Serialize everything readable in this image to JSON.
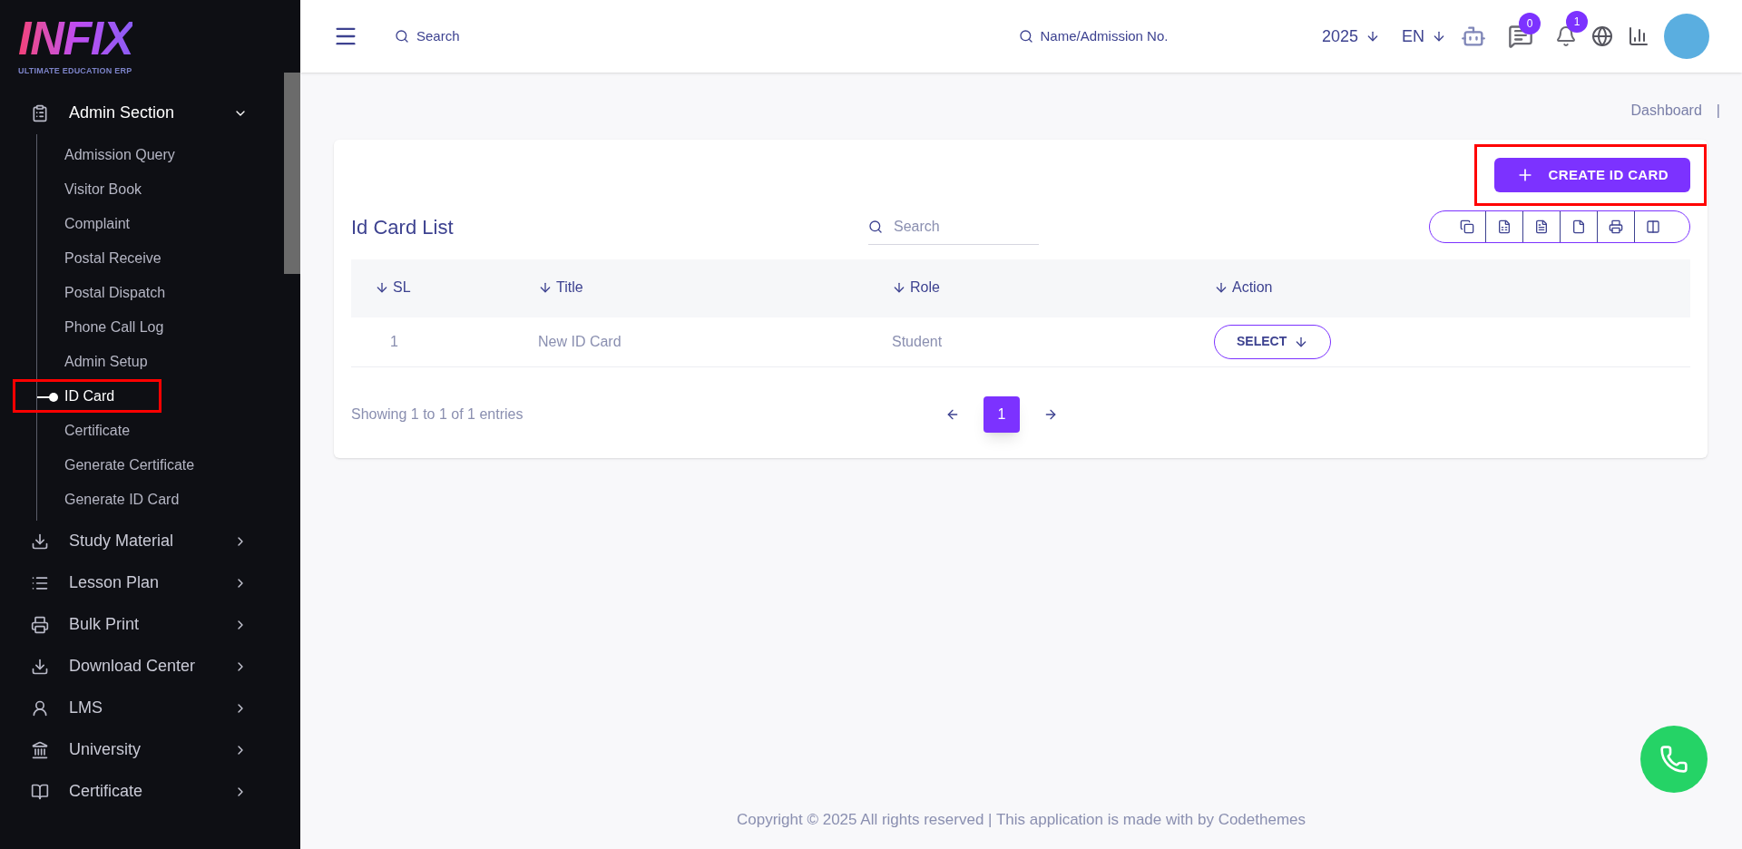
{
  "logo": {
    "title": "INFIX",
    "subtitle": "ULTIMATE EDUCATION ERP"
  },
  "sidebar": {
    "items": [
      {
        "label": "Admin Section",
        "expanded": true,
        "children": [
          {
            "label": "Admission Query",
            "selected": false,
            "highlighted": false
          },
          {
            "label": "Visitor Book",
            "selected": false,
            "highlighted": false
          },
          {
            "label": "Complaint",
            "selected": false,
            "highlighted": false
          },
          {
            "label": "Postal Receive",
            "selected": false,
            "highlighted": false
          },
          {
            "label": "Postal Dispatch",
            "selected": false,
            "highlighted": false
          },
          {
            "label": "Phone Call Log",
            "selected": false,
            "highlighted": false
          },
          {
            "label": "Admin Setup",
            "selected": false,
            "highlighted": false
          },
          {
            "label": "ID Card",
            "selected": true,
            "highlighted": true
          },
          {
            "label": "Certificate",
            "selected": false,
            "highlighted": false
          },
          {
            "label": "Generate Certificate",
            "selected": false,
            "highlighted": false
          },
          {
            "label": "Generate ID Card",
            "selected": false,
            "highlighted": false
          }
        ]
      },
      {
        "label": "Study Material",
        "expanded": false
      },
      {
        "label": "Lesson Plan",
        "expanded": false
      },
      {
        "label": "Bulk Print",
        "expanded": false
      },
      {
        "label": "Download Center",
        "expanded": false
      },
      {
        "label": "LMS",
        "expanded": false
      },
      {
        "label": "University",
        "expanded": false
      },
      {
        "label": "Certificate",
        "expanded": false
      }
    ]
  },
  "header": {
    "search_label": "Search",
    "student_search_label": "Name/Admission No.",
    "year": "2025",
    "language": "EN",
    "messages_count": "0",
    "notifications_count": "1"
  },
  "breadcrumb": [
    "Dashboard",
    "|"
  ],
  "card": {
    "create_button": {
      "label": "CREATE ID CARD",
      "highlighted": true
    },
    "title": "Id Card List",
    "search_placeholder": "Search",
    "table": {
      "columns": [
        "SL",
        "Title",
        "Role",
        "Action"
      ],
      "rows": [
        {
          "sl": "1",
          "title": "New ID Card",
          "role": "Student",
          "action": "SELECT"
        }
      ]
    },
    "info": "Showing 1 to 1 of 1 entries",
    "pages": [
      {
        "label": "1",
        "selected": true
      }
    ]
  },
  "footer": "Copyright © 2025 All rights reserved | This application is made with by Codethemes"
}
